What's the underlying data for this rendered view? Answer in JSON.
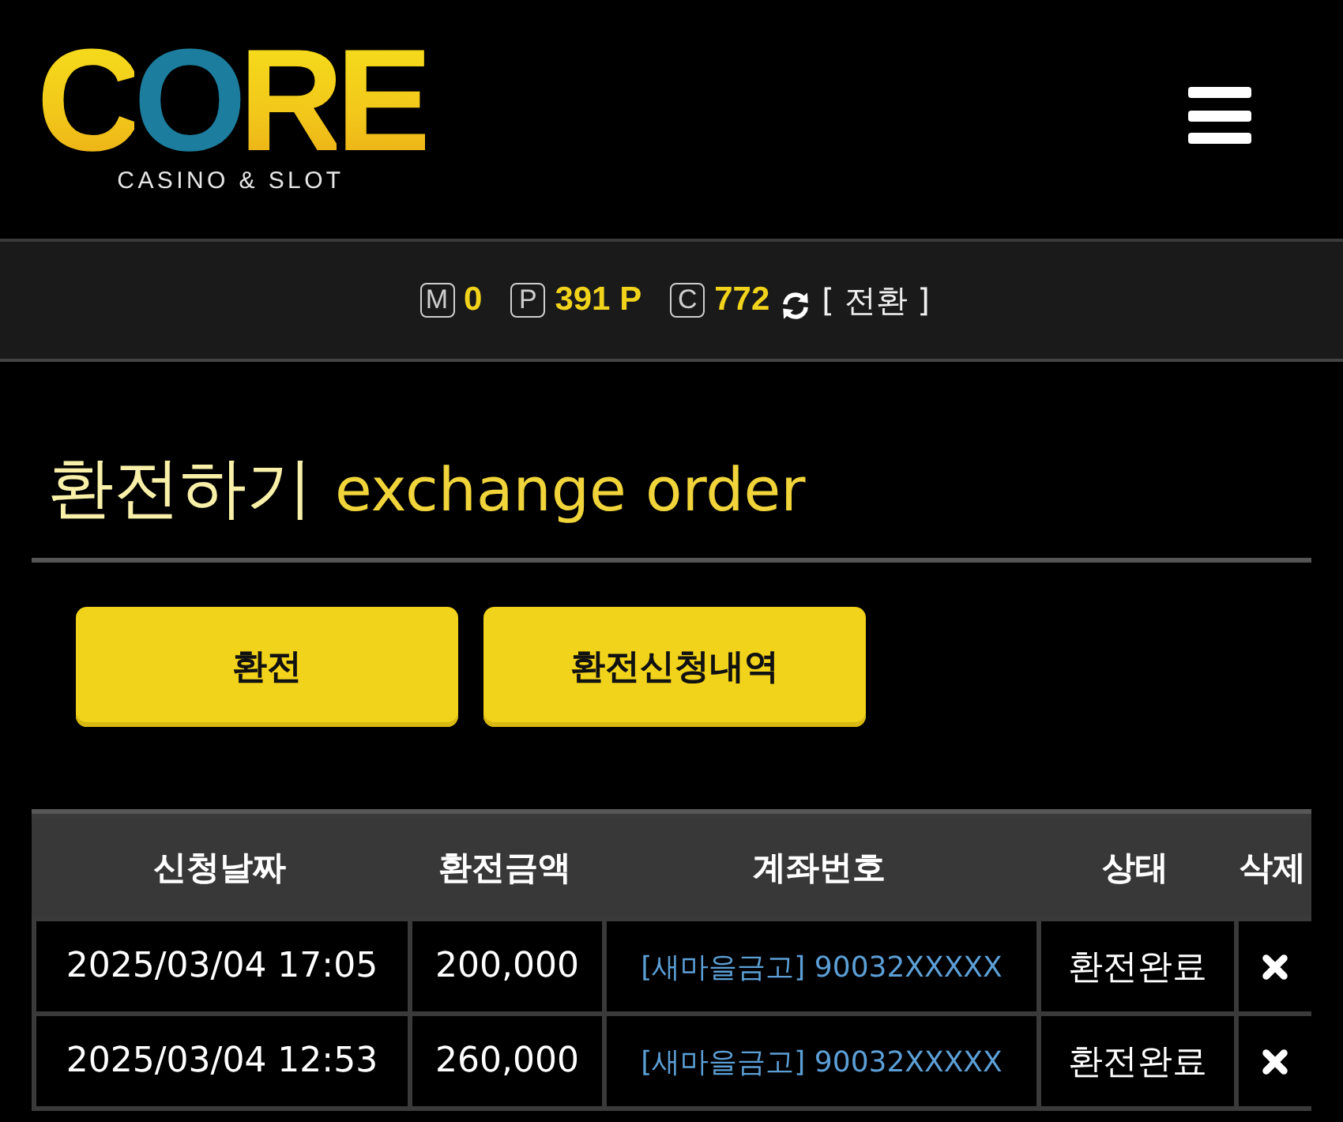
{
  "logo": {
    "wordmark": "CORE",
    "tagline": "CASINO & SLOT"
  },
  "balances": [
    {
      "badge": "M",
      "value": "0"
    },
    {
      "badge": "P",
      "value": "391 P"
    },
    {
      "badge": "C",
      "value": "772"
    }
  ],
  "convert_link": "[ 전환 ]",
  "title": {
    "korean": "환전하기",
    "english": "exchange order"
  },
  "buttons": [
    "환전",
    "환전신청내역"
  ],
  "table": {
    "columns": [
      "신청날짜",
      "환전금액",
      "계좌번호",
      "상태",
      "삭제"
    ],
    "rows": [
      {
        "date": "2025/03/04 17:05",
        "amount": "200,000",
        "account": "[새마을금고] 90032XXXXX",
        "status": "환전완료"
      },
      {
        "date": "2025/03/04 12:53",
        "amount": "260,000",
        "account": "[새마을금고] 90032XXXXX",
        "status": "환전완료"
      }
    ]
  }
}
